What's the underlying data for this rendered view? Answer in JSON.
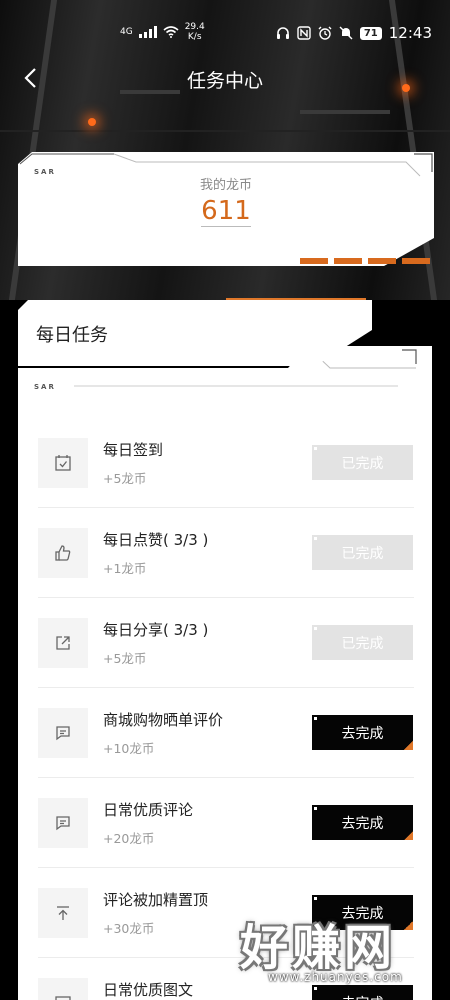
{
  "status_bar": {
    "network": "4G",
    "speed_value": "29.4",
    "speed_unit": "K/s",
    "battery": "71",
    "time": "12:43"
  },
  "nav": {
    "title": "任务中心"
  },
  "coins": {
    "label": "我的龙币",
    "value": "611",
    "logo": "SAR"
  },
  "daily": {
    "title": "每日任务",
    "logo": "SAR"
  },
  "tasks": [
    {
      "name": "每日签到",
      "reward": "+5龙币",
      "status": "已完成",
      "icon": "calendar-check-icon"
    },
    {
      "name": "每日点赞( 3/3 )",
      "reward": "+1龙币",
      "status": "已完成",
      "icon": "thumbs-up-icon"
    },
    {
      "name": "每日分享( 3/3 )",
      "reward": "+5龙币",
      "status": "已完成",
      "icon": "share-icon"
    },
    {
      "name": "商城购物晒单评价",
      "reward": "+10龙币",
      "status": "去完成",
      "icon": "comment-icon"
    },
    {
      "name": "日常优质评论",
      "reward": "+20龙币",
      "status": "去完成",
      "icon": "comment-icon"
    },
    {
      "name": "评论被加精置顶",
      "reward": "+30龙币",
      "status": "去完成",
      "icon": "pin-top-icon"
    },
    {
      "name": "日常优质图文",
      "reward": "",
      "status": "去完成",
      "icon": "image-icon"
    }
  ],
  "watermark": {
    "text": "好赚网",
    "url": "www.zhuanyes.com"
  },
  "colors": {
    "accent": "#d4691c",
    "done_button": "#e3e3e3",
    "todo_button": "#050505"
  }
}
